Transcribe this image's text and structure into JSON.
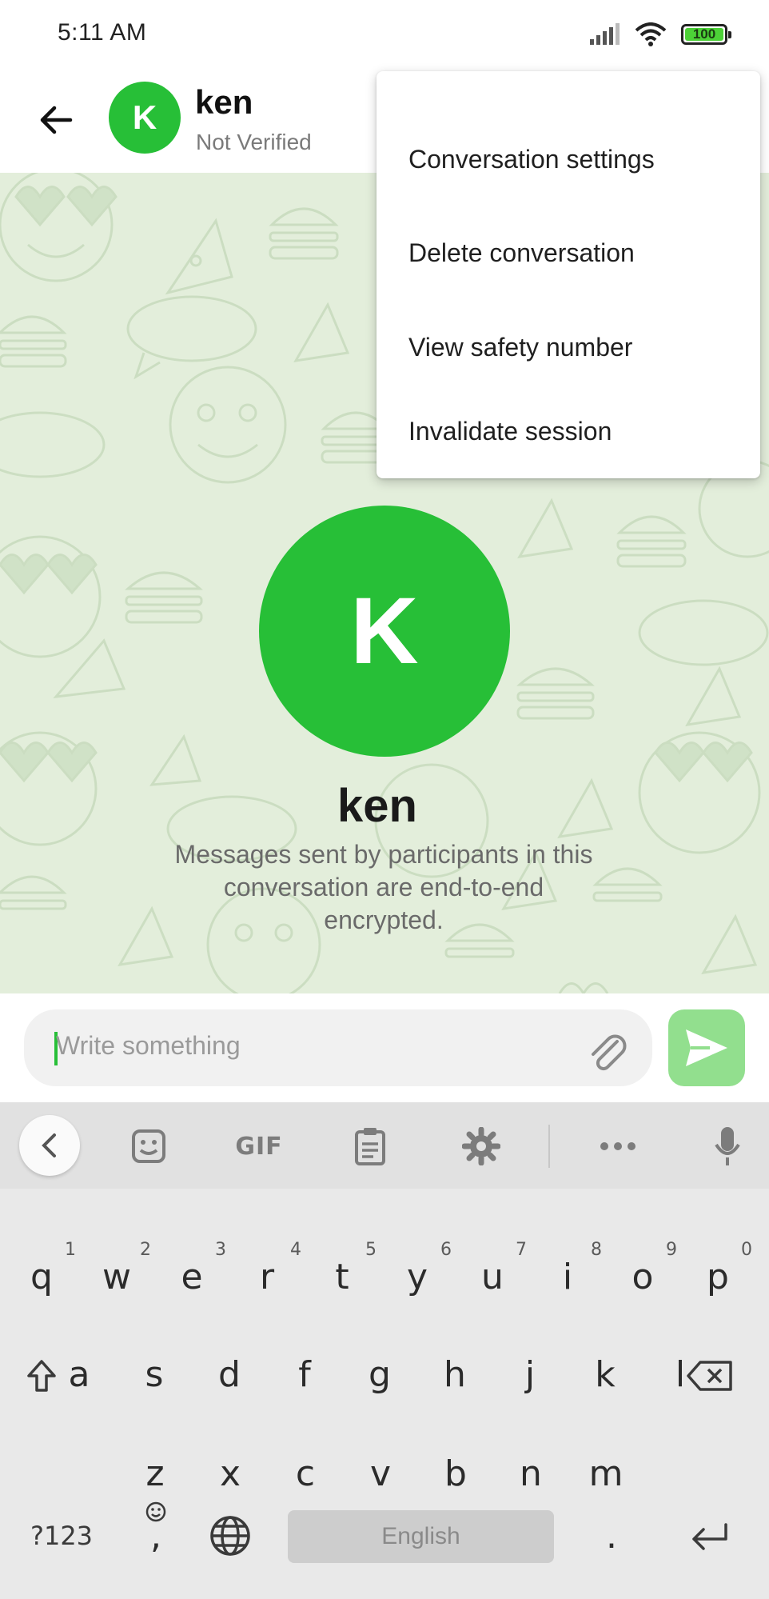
{
  "status_bar": {
    "time": "5:11 AM",
    "battery_level": "100",
    "icons": [
      "signal-icon",
      "wifi-icon",
      "battery-icon"
    ]
  },
  "header": {
    "contact_initial": "K",
    "contact_name": "ken",
    "verification_status": "Not Verified"
  },
  "menu": {
    "items": [
      "Conversation settings",
      "Delete conversation",
      "View safety number",
      "Invalidate session"
    ]
  },
  "conversation": {
    "avatar_initial": "K",
    "name": "ken",
    "encryption_notice": "Messages sent by participants in this conversation are end-to-end encrypted."
  },
  "composer": {
    "placeholder": "Write something"
  },
  "keyboard": {
    "toolbar": {
      "gif_label": "GIF",
      "icons": [
        "collapse-icon",
        "sticker-icon",
        "gif-icon",
        "clipboard-icon",
        "settings-icon",
        "more-icon",
        "microphone-icon"
      ]
    },
    "row1": [
      {
        "key": "q",
        "hint": "1"
      },
      {
        "key": "w",
        "hint": "2"
      },
      {
        "key": "e",
        "hint": "3"
      },
      {
        "key": "r",
        "hint": "4"
      },
      {
        "key": "t",
        "hint": "5"
      },
      {
        "key": "y",
        "hint": "6"
      },
      {
        "key": "u",
        "hint": "7"
      },
      {
        "key": "i",
        "hint": "8"
      },
      {
        "key": "o",
        "hint": "9"
      },
      {
        "key": "p",
        "hint": "0"
      }
    ],
    "row2": [
      "a",
      "s",
      "d",
      "f",
      "g",
      "h",
      "j",
      "k",
      "l"
    ],
    "row3": [
      "z",
      "x",
      "c",
      "v",
      "b",
      "n",
      "m"
    ],
    "symbols_label": "?123",
    "comma_label": ",",
    "space_label": "English",
    "period_label": "."
  },
  "colors": {
    "accent": "#27bf37",
    "send_button": "#92df8e",
    "chat_background": "#e3eedb"
  }
}
